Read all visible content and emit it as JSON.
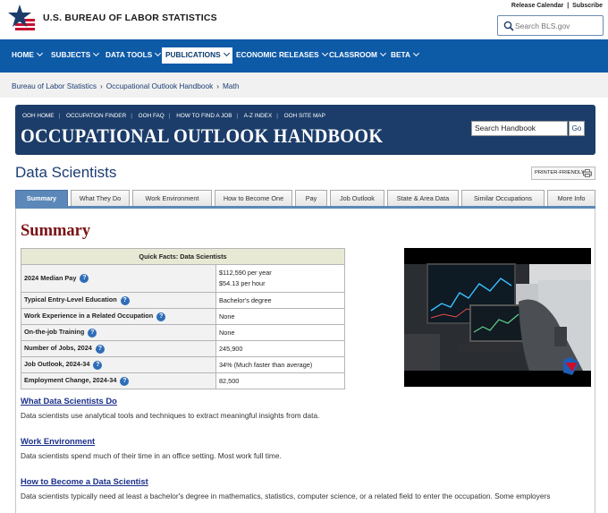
{
  "header": {
    "agency_name": "U.S. BUREAU OF LABOR STATISTICS",
    "release_calendar": "Release Calendar",
    "separator": "|",
    "subscribe": "Subscribe",
    "search_placeholder": "Search BLS.gov"
  },
  "nav": {
    "items": [
      {
        "label": "HOME"
      },
      {
        "label": "SUBJECTS"
      },
      {
        "label": "DATA TOOLS"
      },
      {
        "label": "PUBLICATIONS"
      },
      {
        "label": "ECONOMIC RELEASES"
      },
      {
        "label": "CLASSROOM"
      },
      {
        "label": "BETA"
      }
    ],
    "active_index": 3
  },
  "breadcrumb": [
    "Bureau of Labor Statistics",
    "Occupational Outlook Handbook",
    "Math"
  ],
  "ooh": {
    "links": [
      "OOH HOME",
      "OCCUPATION FINDER",
      "OOH FAQ",
      "HOW TO FIND A JOB",
      "A-Z INDEX",
      "OOH SITE MAP"
    ],
    "title": "OCCUPATIONAL OUTLOOK HANDBOOK",
    "search_value": "Search Handbook",
    "go_label": "Go"
  },
  "page": {
    "title": "Data Scientists",
    "printer_label": "PRINTER-FRIENDLY"
  },
  "tabs": [
    {
      "label": "Summary"
    },
    {
      "label": "What They Do"
    },
    {
      "label": "Work Environment"
    },
    {
      "label": "How to Become One"
    },
    {
      "label": "Pay"
    },
    {
      "label": "Job Outlook"
    },
    {
      "label": "State & Area Data"
    },
    {
      "label": "Similar Occupations"
    },
    {
      "label": "More Info"
    }
  ],
  "summary": {
    "heading": "Summary",
    "quick_facts": {
      "title": "Quick Facts: Data Scientists",
      "rows": [
        {
          "label": "2024 Median Pay",
          "value": "$112,590 per year",
          "value2": "$54.13 per hour"
        },
        {
          "label": "Typical Entry-Level Education",
          "value": "Bachelor's degree"
        },
        {
          "label": "Work Experience in a Related Occupation",
          "value": "None"
        },
        {
          "label": "On-the-job Training",
          "value": "None"
        },
        {
          "label": "Number of Jobs, 2024",
          "value": "245,900"
        },
        {
          "label": "Job Outlook, 2024-34",
          "value": "34% (Much faster than average)"
        },
        {
          "label": "Employment Change, 2024-34",
          "value": "82,500"
        }
      ]
    },
    "sections": [
      {
        "heading": "What Data Scientists Do",
        "text": "Data scientists use analytical tools and techniques to extract meaningful insights from data."
      },
      {
        "heading": "Work Environment",
        "text": "Data scientists spend much of their time in an office setting. Most work full time."
      },
      {
        "heading": "How to Become a Data Scientist",
        "text": "Data scientists typically need at least a bachelor's degree in mathematics, statistics, computer science, or a related field to enter the occupation. Some employers"
      }
    ]
  }
}
